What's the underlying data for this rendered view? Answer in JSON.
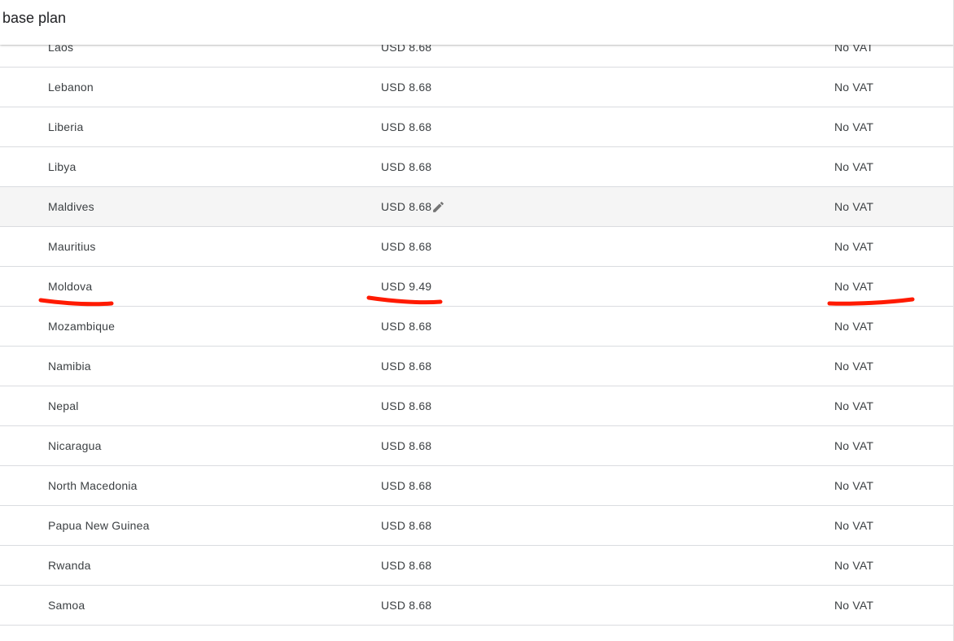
{
  "header": {
    "title": "t base plan"
  },
  "table": {
    "rows": [
      {
        "country": "Laos",
        "price": "USD 8.68",
        "vat": "No VAT"
      },
      {
        "country": "Lebanon",
        "price": "USD 8.68",
        "vat": "No VAT"
      },
      {
        "country": "Liberia",
        "price": "USD 8.68",
        "vat": "No VAT"
      },
      {
        "country": "Libya",
        "price": "USD 8.68",
        "vat": "No VAT"
      },
      {
        "country": "Maldives",
        "price": "USD 8.68",
        "vat": "No VAT",
        "hovered": true,
        "icon": "edit-pencil-icon"
      },
      {
        "country": "Mauritius",
        "price": "USD 8.68",
        "vat": "No VAT"
      },
      {
        "country": "Moldova",
        "price": "USD 9.49",
        "vat": "No VAT",
        "annotated": true
      },
      {
        "country": "Mozambique",
        "price": "USD 8.68",
        "vat": "No VAT"
      },
      {
        "country": "Namibia",
        "price": "USD 8.68",
        "vat": "No VAT"
      },
      {
        "country": "Nepal",
        "price": "USD 8.68",
        "vat": "No VAT"
      },
      {
        "country": "Nicaragua",
        "price": "USD 8.68",
        "vat": "No VAT"
      },
      {
        "country": "North Macedonia",
        "price": "USD 8.68",
        "vat": "No VAT"
      },
      {
        "country": "Papua New Guinea",
        "price": "USD 8.68",
        "vat": "No VAT"
      },
      {
        "country": "Rwanda",
        "price": "USD 8.68",
        "vat": "No VAT"
      },
      {
        "country": "Samoa",
        "price": "USD 8.68",
        "vat": "No VAT"
      }
    ]
  },
  "colors": {
    "text": "#3c4043",
    "divider": "#dadce0",
    "hover_row": "#f5f5f5",
    "annotation": "#ff1a00"
  }
}
